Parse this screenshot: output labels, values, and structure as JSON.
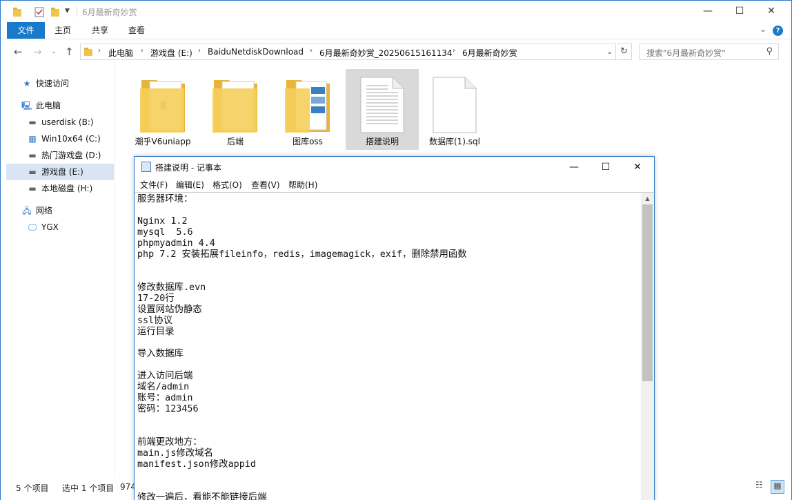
{
  "explorer": {
    "title": "6月最新奇妙赏",
    "ribbon": {
      "file": "文件",
      "home": "主页",
      "share": "共享",
      "view": "查看",
      "help": "?"
    },
    "address": {
      "crumbs": [
        "此电脑",
        "游戏盘 (E:)",
        "BaiduNetdiskDownload",
        "6月最新奇妙赏_20250615161134",
        "6月最新奇妙赏"
      ]
    },
    "search_placeholder": "搜索\"6月最新奇妙赏\"",
    "nav": {
      "quick_access": "快速访问",
      "this_pc": "此电脑",
      "drives": [
        "userdisk (B:)",
        "Win10x64 (C:)",
        "热门游戏盘 (D:)",
        "游戏盘 (E:)",
        "本地磁盘 (H:)"
      ],
      "network": "网络",
      "network_host": "YGX"
    },
    "files": [
      {
        "name": "潮乎V6uniapp",
        "type": "folder"
      },
      {
        "name": "后端",
        "type": "folder"
      },
      {
        "name": "图库oss",
        "type": "folder"
      },
      {
        "name": "搭建说明",
        "type": "text"
      },
      {
        "name": "数据库(1).sql",
        "type": "file"
      }
    ],
    "status": {
      "count": "5 个项目",
      "selected": "选中 1 个项目",
      "size": "974"
    }
  },
  "notepad": {
    "title": "搭建说明 - 记事本",
    "menu": [
      "文件(F)",
      "编辑(E)",
      "格式(O)",
      "查看(V)",
      "帮助(H)"
    ],
    "lines": [
      "服务器环境：",
      "",
      "Nginx 1.2",
      "mysql  5.6",
      "phpmyadmin 4.4",
      "php 7.2 安装拓展fileinfo，redis，imagemagick，exif，删除禁用函数",
      "",
      "",
      "修改数据库.evn",
      "17-20行",
      "设置网站伪静态",
      "ssl协议",
      "运行目录",
      "",
      "导入数据库",
      "",
      "进入访问后端",
      "域名/admin",
      "账号：admin",
      "密码：123456",
      "",
      "",
      "前端更改地方：",
      "main.js修改域名",
      "manifest.json修改appid",
      "",
      "",
      "修改一遍后，看能不能链接后端"
    ]
  }
}
